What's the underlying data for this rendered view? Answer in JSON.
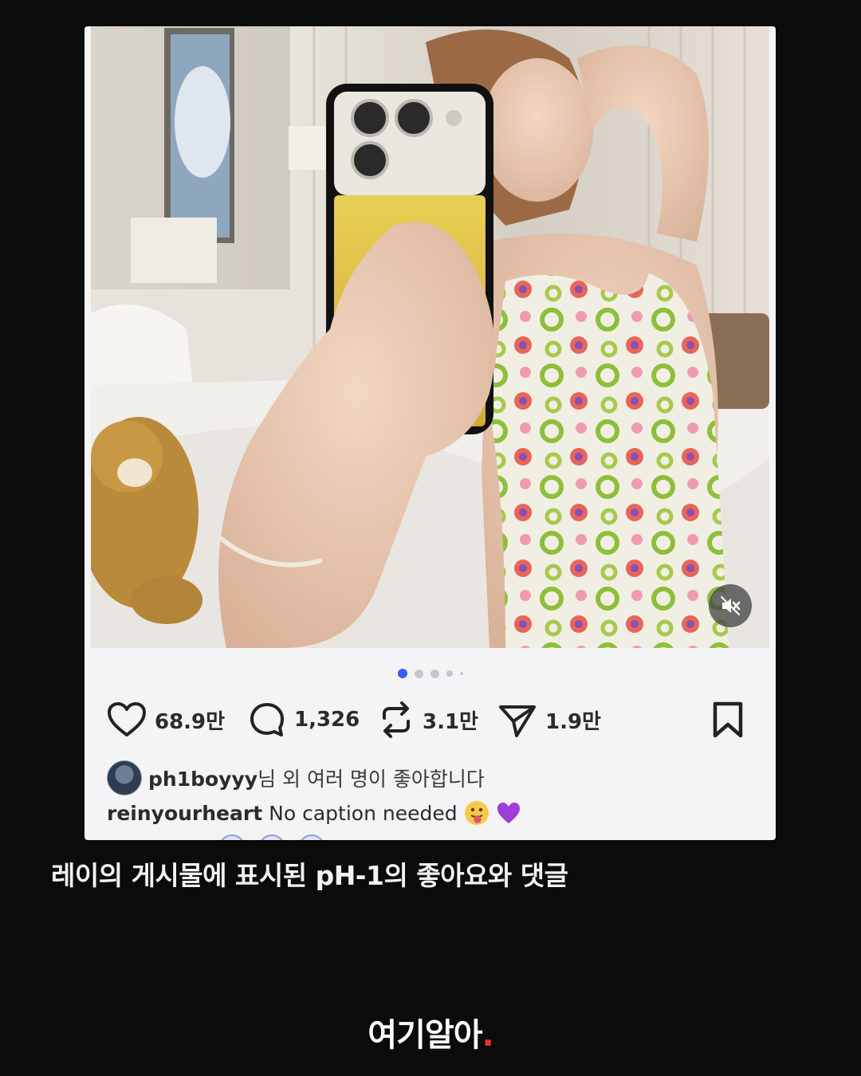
{
  "post": {
    "stats": {
      "likes": "68.9만",
      "comments": "1,326",
      "reposts": "3.1만",
      "shares": "1.9만"
    },
    "liked_by": {
      "user": "ph1boyyy",
      "suffix": "님 외 여러 명이 좋아합니다"
    },
    "caption": {
      "user": "reinyourheart",
      "text": "No caption needed"
    },
    "carousel": {
      "count": 5,
      "active_index": 0
    },
    "icons": [
      "heart-icon",
      "comment-icon",
      "repost-icon",
      "share-icon",
      "bookmark-icon",
      "mute-icon"
    ],
    "emojis": [
      "tongue-face-emoji",
      "purple-heart-emoji"
    ]
  },
  "description": "레이의 게시물에 표시된 pH-1의 좋아요와 댓글",
  "brand": {
    "name": "여기알아",
    "dot": "."
  },
  "colors": {
    "background": "#0b0b0b",
    "card": "#f4f4f6",
    "carousel_active": "#3d5bf5",
    "brand_dot": "#e8332c"
  }
}
